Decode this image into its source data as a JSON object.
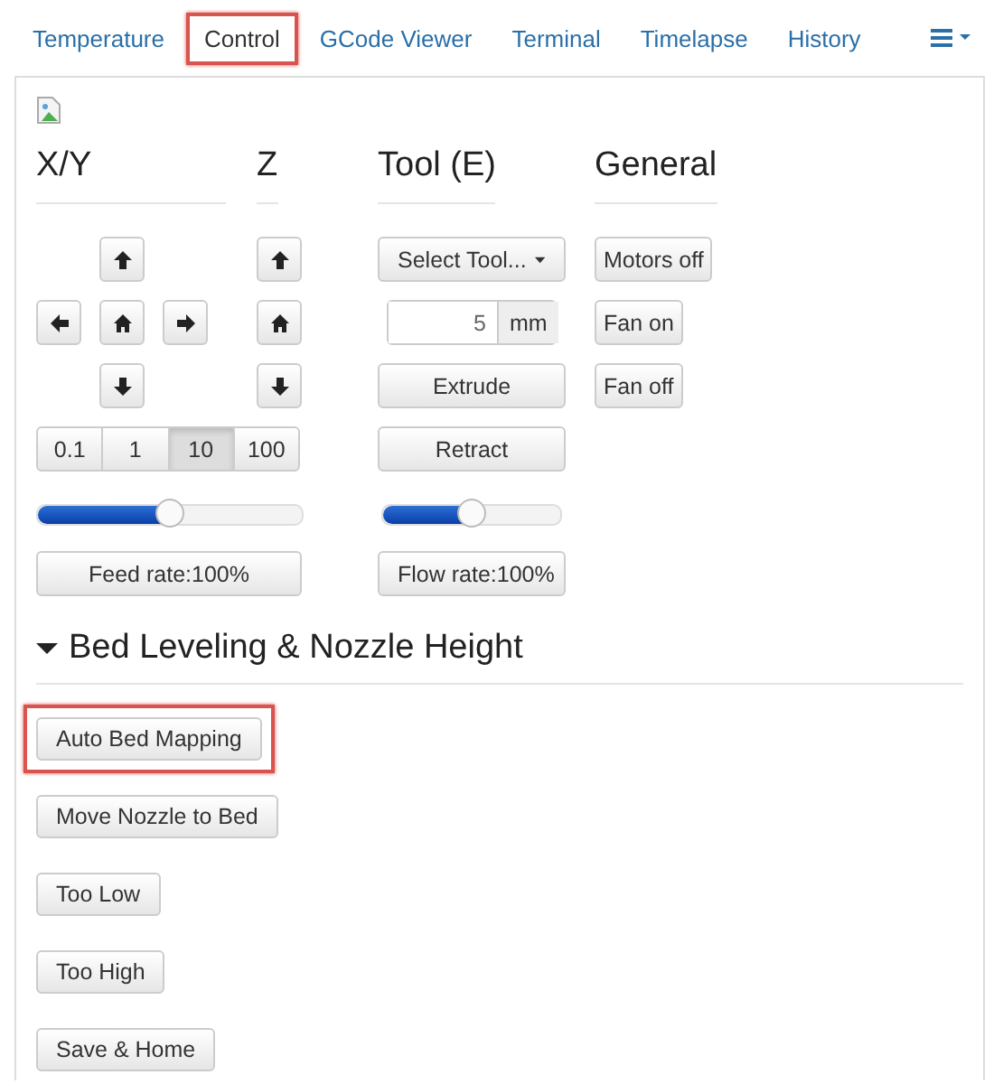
{
  "tabs": [
    {
      "label": "Temperature",
      "selected": false,
      "highlighted": false
    },
    {
      "label": "Control",
      "selected": true,
      "highlighted": true
    },
    {
      "label": "GCode Viewer",
      "selected": false,
      "highlighted": false
    },
    {
      "label": "Terminal",
      "selected": false,
      "highlighted": false
    },
    {
      "label": "Timelapse",
      "selected": false,
      "highlighted": false
    },
    {
      "label": "History",
      "selected": false,
      "highlighted": false
    }
  ],
  "control": {
    "headings": [
      "X/Y",
      "Z",
      "Tool (E)",
      "General"
    ],
    "xy_jog": [
      {
        "kind": "up"
      },
      {
        "kind": "left"
      },
      {
        "kind": "home"
      },
      {
        "kind": "right"
      },
      {
        "kind": "down"
      }
    ],
    "z_jog": [
      {
        "kind": "up"
      },
      {
        "kind": "home"
      },
      {
        "kind": "down"
      }
    ],
    "steps": [
      {
        "label": "0.1",
        "selected": false
      },
      {
        "label": "1",
        "selected": false
      },
      {
        "label": "10",
        "selected": true
      },
      {
        "label": "100",
        "selected": false
      }
    ],
    "feed_rate": {
      "level": 0.5,
      "label": "Feed rate:100%"
    },
    "tool": {
      "select_label": "Select Tool...",
      "amount": "5",
      "unit": "mm",
      "buttons": [
        "Extrude",
        "Retract"
      ],
      "flow_rate": {
        "level": 0.5,
        "label": "Flow rate:100%"
      }
    },
    "general": [
      "Motors off",
      "Fan on",
      "Fan off"
    ]
  },
  "bed_leveling": {
    "title": "Bed Leveling & Nozzle Height",
    "expanded": true,
    "buttons": [
      {
        "label": "Auto Bed Mapping",
        "highlighted": true
      },
      {
        "label": "Move Nozzle to Bed",
        "highlighted": false
      },
      {
        "label": "Too Low",
        "highlighted": false
      },
      {
        "label": "Too High",
        "highlighted": false
      },
      {
        "label": "Save & Home",
        "highlighted": false
      }
    ]
  }
}
